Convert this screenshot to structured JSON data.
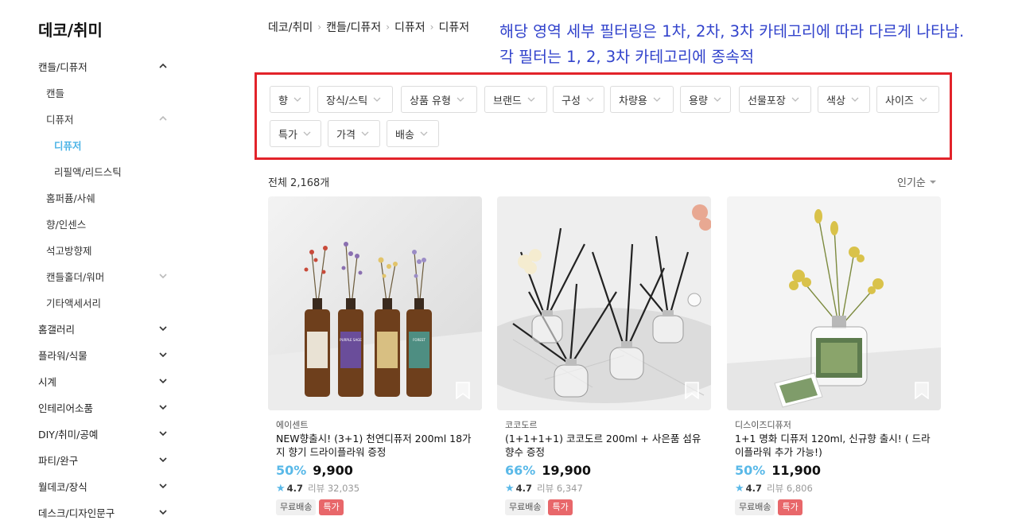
{
  "sidebar": {
    "title": "데코/취미",
    "items": [
      {
        "label": "캔들/디퓨저",
        "chevron": "up"
      },
      {
        "label": "캔들",
        "chevron": ""
      },
      {
        "label": "디퓨저",
        "chevron": "up-light"
      },
      {
        "label": "디퓨저",
        "chevron": ""
      },
      {
        "label": "리필액/리드스틱",
        "chevron": ""
      },
      {
        "label": "홈퍼퓸/사쉐",
        "chevron": ""
      },
      {
        "label": "향/인센스",
        "chevron": ""
      },
      {
        "label": "석고방향제",
        "chevron": ""
      },
      {
        "label": "캔들홀더/워머",
        "chevron": "down-light"
      },
      {
        "label": "기타액세서리",
        "chevron": ""
      },
      {
        "label": "홈갤러리",
        "chevron": "down"
      },
      {
        "label": "플라워/식물",
        "chevron": "down"
      },
      {
        "label": "시계",
        "chevron": "down"
      },
      {
        "label": "인테리어소품",
        "chevron": "down"
      },
      {
        "label": "DIY/취미/공예",
        "chevron": "down"
      },
      {
        "label": "파티/완구",
        "chevron": "down"
      },
      {
        "label": "월데코/장식",
        "chevron": "down"
      },
      {
        "label": "데스크/디자인문구",
        "chevron": "down"
      }
    ]
  },
  "breadcrumb": [
    "데코/취미",
    "캔들/디퓨저",
    "디퓨저",
    "디퓨저"
  ],
  "annotation": {
    "line1": "해당 영역 세부 필터링은 1차, 2차, 3차 카테고리에 따라 다르게 나타남.",
    "line2": "각 필터는 1, 2, 3차 카테고리에 종속적"
  },
  "filters": [
    "향",
    "장식/스틱",
    "상품 유형",
    "브랜드",
    "구성",
    "차량용",
    "용량",
    "선물포장",
    "색상",
    "사이즈",
    "특가",
    "가격",
    "배송"
  ],
  "listing": {
    "total": "전체 2,168개",
    "sort": "인기순"
  },
  "products": [
    {
      "brand": "에이센트",
      "name": "NEW향출시! (3+1) 천연디퓨저 200ml 18가지 향기 드라이플라워 증정",
      "discount": "50%",
      "price": "9,900",
      "score": "4.7",
      "reviews": "리뷰 32,035",
      "badge_free": "무료배송",
      "badge_sale": "특가",
      "bottle_labels": [
        "",
        "PURPLE SAGE",
        "",
        "FOREST"
      ]
    },
    {
      "brand": "코코도르",
      "name": "(1+1+1+1) 코코도르 200ml + 사은품 섬유향수 증정",
      "discount": "66%",
      "price": "19,900",
      "score": "4.7",
      "reviews": "리뷰 6,347",
      "badge_free": "무료배송",
      "badge_sale": "특가"
    },
    {
      "brand": "디스이즈디퓨저",
      "name": "1+1 명화 디퓨저 120ml, 신규향 출시! ( 드라이플라워 추가 가능!)",
      "discount": "50%",
      "price": "11,900",
      "score": "4.7",
      "reviews": "리뷰 6,806",
      "badge_free": "무료배송",
      "badge_sale": "특가"
    }
  ],
  "colors": {
    "accent": "#4db4e6",
    "annotation": "#3344cc",
    "highlight_border": "#e2232a",
    "sale_badge": "#e8676a"
  }
}
